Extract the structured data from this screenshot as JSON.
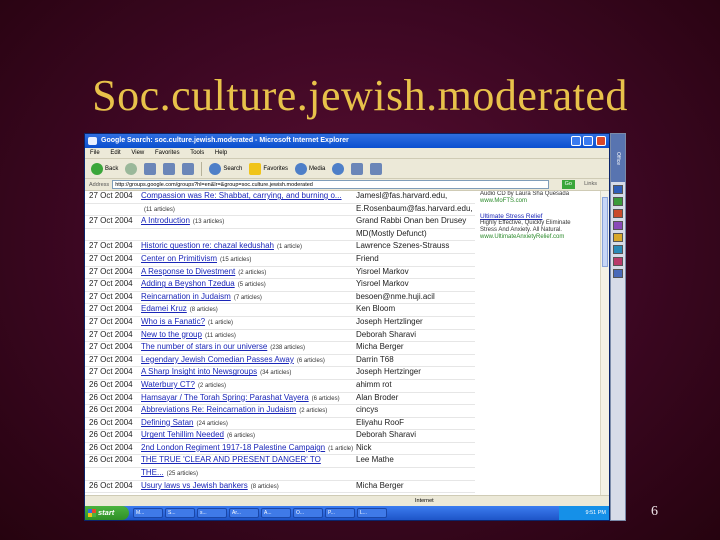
{
  "slide": {
    "title": "Soc.culture.jewish.moderated",
    "number": "6"
  },
  "window": {
    "title": "Google Search: soc.culture.jewish.moderated - Microsoft Internet Explorer",
    "menu": [
      "File",
      "Edit",
      "View",
      "Favorites",
      "Tools",
      "Help"
    ],
    "toolbar": {
      "back": "Back",
      "search": "Search",
      "favorites": "Favorites",
      "media": "Media"
    },
    "address": {
      "label": "Address",
      "url": "http://groups.google.com/groups?hl=en&lr=&group=soc.culture.jewish.moderated",
      "go": "Go",
      "links": "Links"
    },
    "status": "Internet",
    "taskbar": {
      "start": "start",
      "clock": "9:51 PM",
      "items": [
        "M...",
        "S...",
        "s...",
        "Ar...",
        "A...",
        "O...",
        "P...",
        "L..."
      ]
    },
    "side_panel": "Office"
  },
  "rows": [
    {
      "date": "27 Oct 2004",
      "subject": "Compassion was Re: Shabbat, carrying, and burning o...",
      "count": "",
      "author": "Jamesl@fas.harvard.edu,"
    },
    {
      "date": "",
      "subject": "",
      "count": "(11 articles)",
      "author": "E.Rosenbaum@fas.harvard.edu,"
    },
    {
      "date": "27 Oct 2004",
      "subject": "A Introduction",
      "count": "(13 articles)",
      "author": "Grand Rabbi Onan ben Drusey"
    },
    {
      "date": "",
      "subject": "",
      "count": "",
      "author": "MD(Mostly Defunct)"
    },
    {
      "date": "27 Oct 2004",
      "subject": "Historic question re: chazal kedushah",
      "count": "(1 article)",
      "author": "Lawrence Szenes-Strauss"
    },
    {
      "date": "27 Oct 2004",
      "subject": "Center on Primitivism",
      "count": "(15 articles)",
      "author": "Friend"
    },
    {
      "date": "27 Oct 2004",
      "subject": "A Response to Divestment",
      "count": "(2 articles)",
      "author": "Yisroel Markov"
    },
    {
      "date": "27 Oct 2004",
      "subject": "Adding a Beyshon Tzedua",
      "count": "(5 articles)",
      "author": "Yisroel Markov"
    },
    {
      "date": "27 Oct 2004",
      "subject": "Reincarnation in Judaism",
      "count": "(7 articles)",
      "author": "besoen@nme.huji.acil"
    },
    {
      "date": "27 Oct 2004",
      "subject": "Edamei Kruz",
      "count": "(8 articles)",
      "author": "Ken Bloom"
    },
    {
      "date": "27 Oct 2004",
      "subject": "Who is a Fanatic?",
      "count": "(1 article)",
      "author": "Joseph Hertzlinger"
    },
    {
      "date": "27 Oct 2004",
      "subject": "New to the group",
      "count": "(11 articles)",
      "author": "Deborah Sharavi"
    },
    {
      "date": "27 Oct 2004",
      "subject": "The number of stars in our universe",
      "count": "(238 articles)",
      "author": "Micha Berger"
    },
    {
      "date": "27 Oct 2004",
      "subject": "Legendary Jewish Comedian Passes Away",
      "count": "(6 articles)",
      "author": "Darrin T68"
    },
    {
      "date": "27 Oct 2004",
      "subject": "A Sharp Insight into Newsgroups",
      "count": "(34 articles)",
      "author": "Joseph Hertzinger"
    },
    {
      "date": "26 Oct 2004",
      "subject": "Waterbury CT?",
      "count": "(2 articles)",
      "author": "ahimm rot"
    },
    {
      "date": "26 Oct 2004",
      "subject": "Hamsayar / The Torah Spring: Parashat Vayera",
      "count": "(6 articles)",
      "author": "Alan Broder"
    },
    {
      "date": "26 Oct 2004",
      "subject": "Abbreviations Re: Reincarnation in Judaism",
      "count": "(2 articles)",
      "author": "cincys"
    },
    {
      "date": "26 Oct 2004",
      "subject": "Defining Satan",
      "count": "(24 articles)",
      "author": "Eliyahu RooF"
    },
    {
      "date": "26 Oct 2004",
      "subject": "Urgent Tehillim Needed",
      "count": "(6 articles)",
      "author": "Deborah Sharavi"
    },
    {
      "date": "26 Oct 2004",
      "subject": "2nd London Regiment 1917-18 Palestine Campaign",
      "count": "(1 article)",
      "author": "Nick"
    },
    {
      "date": "26 Oct 2004",
      "subject": "THE TRUE 'CLEAR AND PRESENT DANGER' TO",
      "count": "",
      "author": "Lee Mathe"
    },
    {
      "date": "",
      "subject": "THE...",
      "count": "(25 articles)",
      "author": ""
    },
    {
      "date": "26 Oct 2004",
      "subject": "Usury laws vs Jewish bankers",
      "count": "(8 articles)",
      "author": "Micha Berger"
    }
  ],
  "ads": [
    {
      "title": "",
      "lines": [
        "Audio CD by Laura Sha Quesada"
      ],
      "url": "www.MoFTS.com"
    },
    {
      "title": "Ultimate Stress Relief",
      "lines": [
        "Highly Effective, Quickly Eliminate",
        "Stress And Anxiety. All Natural."
      ],
      "url": "www.UltimateAnxietyRelief.com"
    }
  ]
}
